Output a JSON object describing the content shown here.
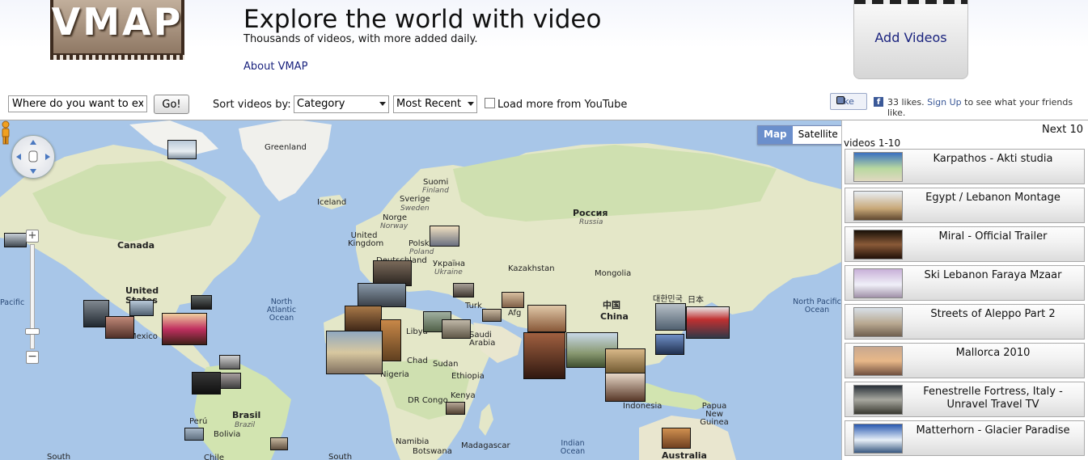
{
  "header": {
    "logo_text": "VMAP",
    "title": "Explore the world with video",
    "subtitle": "Thousands of videos, with more added daily.",
    "about_link": "About VMAP",
    "add_videos_label": "Add Videos"
  },
  "controls": {
    "search_value": "Where do you want to expl",
    "go_label": "Go!",
    "sort_label": "Sort videos by:",
    "sort_by_selected": "Category",
    "order_selected": "Most Recent",
    "load_more_label": "Load more from YouTube",
    "load_more_checked": false
  },
  "facebook": {
    "like_label": "Like",
    "likes_text": "33 likes.",
    "signup_link": "Sign Up",
    "signup_suffix": "to see what your friends like."
  },
  "map": {
    "map_type_options": [
      "Map",
      "Satellite"
    ],
    "map_type_selected": "Map",
    "zoom_in": "+",
    "zoom_out": "−",
    "labels": {
      "greenland": "Greenland",
      "iceland": "Iceland",
      "suomi": "Suomi",
      "finland": "Finland",
      "sverige": "Sverige",
      "sweden": "Sweden",
      "norge": "Norge",
      "norway": "Norway",
      "united_kingdom": "United Kingdom",
      "polska": "Polska",
      "poland": "Poland",
      "deutschland": "Deutschland",
      "ukraina": "Україна",
      "ukraine": "Ukraine",
      "rossiya": "Россия",
      "russia": "Russia",
      "kazakhstan": "Kazakhstan",
      "mongolia": "Mongolia",
      "zhongguo": "中国",
      "china": "China",
      "korea": "대한민국",
      "nihon": "日本",
      "canada": "Canada",
      "united_states": "United States",
      "mexico": "Mexico",
      "north_atlantic": "North Atlantic Ocean",
      "north_pacific_right": "North Pacific Ocean",
      "pacific_left": "Pacific",
      "brasil": "Brasil",
      "brazil": "Brazil",
      "peru": "Perú",
      "bolivia": "Bolivia",
      "chile": "Chile",
      "libya": "Libya",
      "chad": "Chad",
      "sudan": "Sudan",
      "nigeria": "Nigeria",
      "ethiopia": "Ethiopia",
      "kenya": "Kenya",
      "dr_congo": "DR Congo",
      "namibia": "Namibia",
      "botswana": "Botswana",
      "madagascar": "Madagascar",
      "indian_ocean": "Indian Ocean",
      "indonesia": "Indonesia",
      "papua": "Papua New Guinea",
      "australia": "Australia",
      "saudi_arabia": "Saudi Arabia",
      "turk": "Turk",
      "afg": "Afg",
      "south_left": "South",
      "south_mid": "South"
    }
  },
  "sidebar": {
    "next_label": "Next 10",
    "range_label": "videos 1-10",
    "videos": [
      {
        "title": "Karpathos - Akti studia"
      },
      {
        "title": "Egypt / Lebanon Montage"
      },
      {
        "title": "Miral - Official Trailer"
      },
      {
        "title": "Ski Lebanon Faraya Mzaar"
      },
      {
        "title": "Streets of Aleppo Part 2"
      },
      {
        "title": "Mallorca 2010"
      },
      {
        "title": "Fenestrelle Fortress, Italy - Unravel Travel TV"
      },
      {
        "title": "Matterhorn - Glacier Paradise"
      }
    ]
  },
  "colors": {
    "link": "#1a237e",
    "water": "#a8c6e8",
    "land": "#e4e7c8",
    "land_green": "#c8dca8",
    "map_type_active": "#6b8fcc"
  }
}
